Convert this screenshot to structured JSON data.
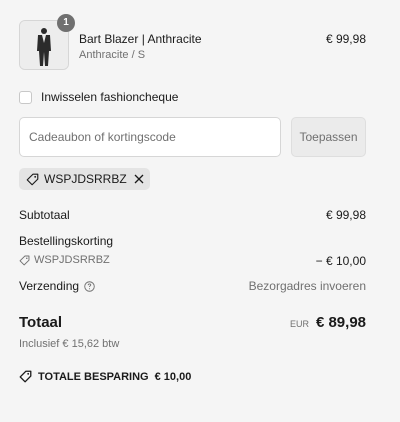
{
  "product": {
    "quantity": "1",
    "name": "Bart Blazer | Anthracite",
    "variant": "Anthracite / S",
    "price": "€ 99,98"
  },
  "fashioncheque": {
    "label": "Inwisselen fashioncheque",
    "checked": false
  },
  "discount": {
    "placeholder": "Cadeaubon of kortingscode",
    "value": "",
    "apply_label": "Toepassen",
    "applied_code": "WSPJDSRRBZ"
  },
  "summary": {
    "subtotal_label": "Subtotaal",
    "subtotal_value": "€ 99,98",
    "order_discount_label": "Bestellingskorting",
    "order_discount_code": "WSPJDSRRBZ",
    "order_discount_value": "− € 10,00",
    "shipping_label": "Verzending",
    "shipping_value": "Bezorgadres invoeren",
    "total_label": "Totaal",
    "total_currency": "EUR",
    "total_value": "€ 89,98",
    "tax_note": "Inclusief € 15,62 btw",
    "savings_label": "TOTALE BESPARING",
    "savings_value": "€ 10,00"
  },
  "colors": {
    "text": "#1a1a1a",
    "muted": "#707070",
    "background": "#f5f5f5",
    "chip": "#e4e4e4"
  },
  "icons": {
    "discount_tag": "tag-icon",
    "remove_code": "close-icon",
    "shipping_info": "help-circle-icon",
    "savings": "tag-icon"
  }
}
